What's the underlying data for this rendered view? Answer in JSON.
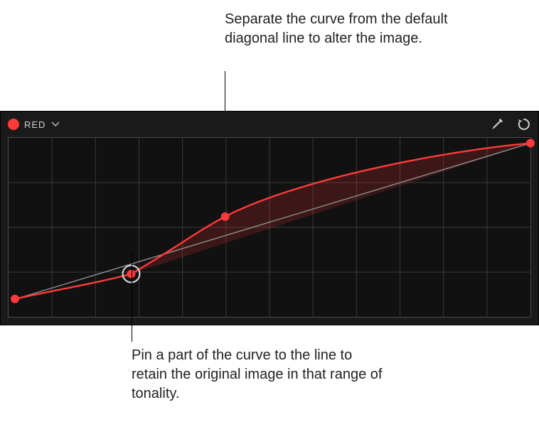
{
  "annotations": {
    "top": "Separate the curve from the default diagonal line to alter the image.",
    "bottom": "Pin a part of the curve to the line to retain the original image in that range of tonality."
  },
  "panel": {
    "channel": {
      "label": "RED",
      "color": "#ff3a3a"
    },
    "icons": {
      "eyedropper": "eyedropper-icon",
      "reset": "reset-icon"
    },
    "curve": {
      "grid_cols": 12,
      "grid_rows": 4,
      "diagonal": {
        "x1": 0,
        "y1": 1,
        "x2": 1,
        "y2": 0
      },
      "points": [
        {
          "x": 0.0,
          "y": 0.9,
          "pinned": false
        },
        {
          "x": 0.235,
          "y": 0.76,
          "pinned": true
        },
        {
          "x": 0.415,
          "y": 0.44,
          "pinned": false
        },
        {
          "x": 1.0,
          "y": 0.03,
          "pinned": false
        }
      ]
    }
  }
}
